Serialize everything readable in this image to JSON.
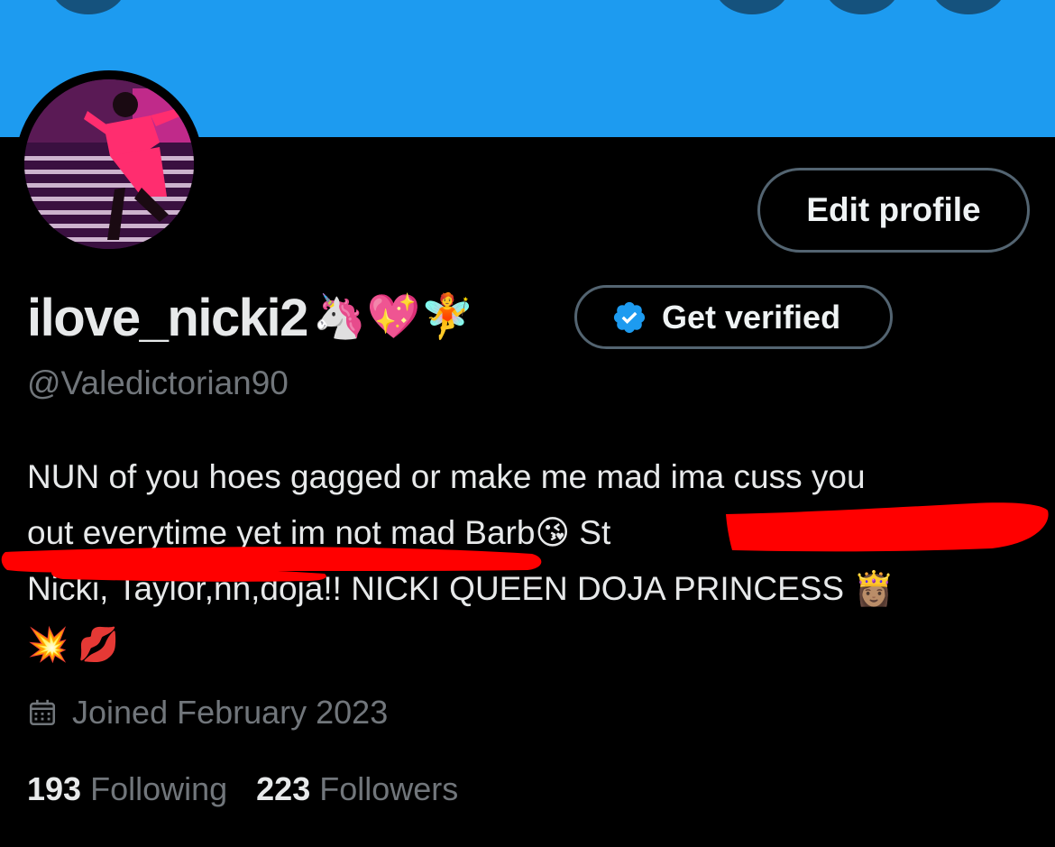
{
  "profile": {
    "display_name": "ilove_nicki2",
    "name_emoji": "🦄💖🧚",
    "handle": "@Valedictorian90",
    "edit_label": "Edit profile",
    "verify_label": "Get verified",
    "bio_line1": "NUN of you hoes gagged or make me mad ima cuss you",
    "bio_line2": "out everytime yet im not mad Barb😘  St",
    "bio_line3": "Nicki, Taylor,nn,doja!! NICKI QUEEN DOJA PRINCESS 👸🏽",
    "bio_line4": "💥 💋",
    "joined": "Joined February 2023",
    "following_count": "193",
    "following_label": "Following",
    "followers_count": "223",
    "followers_label": "Followers"
  },
  "colors": {
    "banner": "#1d9bf0",
    "verified_badge": "#1d9bf0",
    "redaction": "#ff0000",
    "muted_text": "#71767b"
  },
  "icons": [
    "verified-badge-icon",
    "calendar-icon"
  ]
}
